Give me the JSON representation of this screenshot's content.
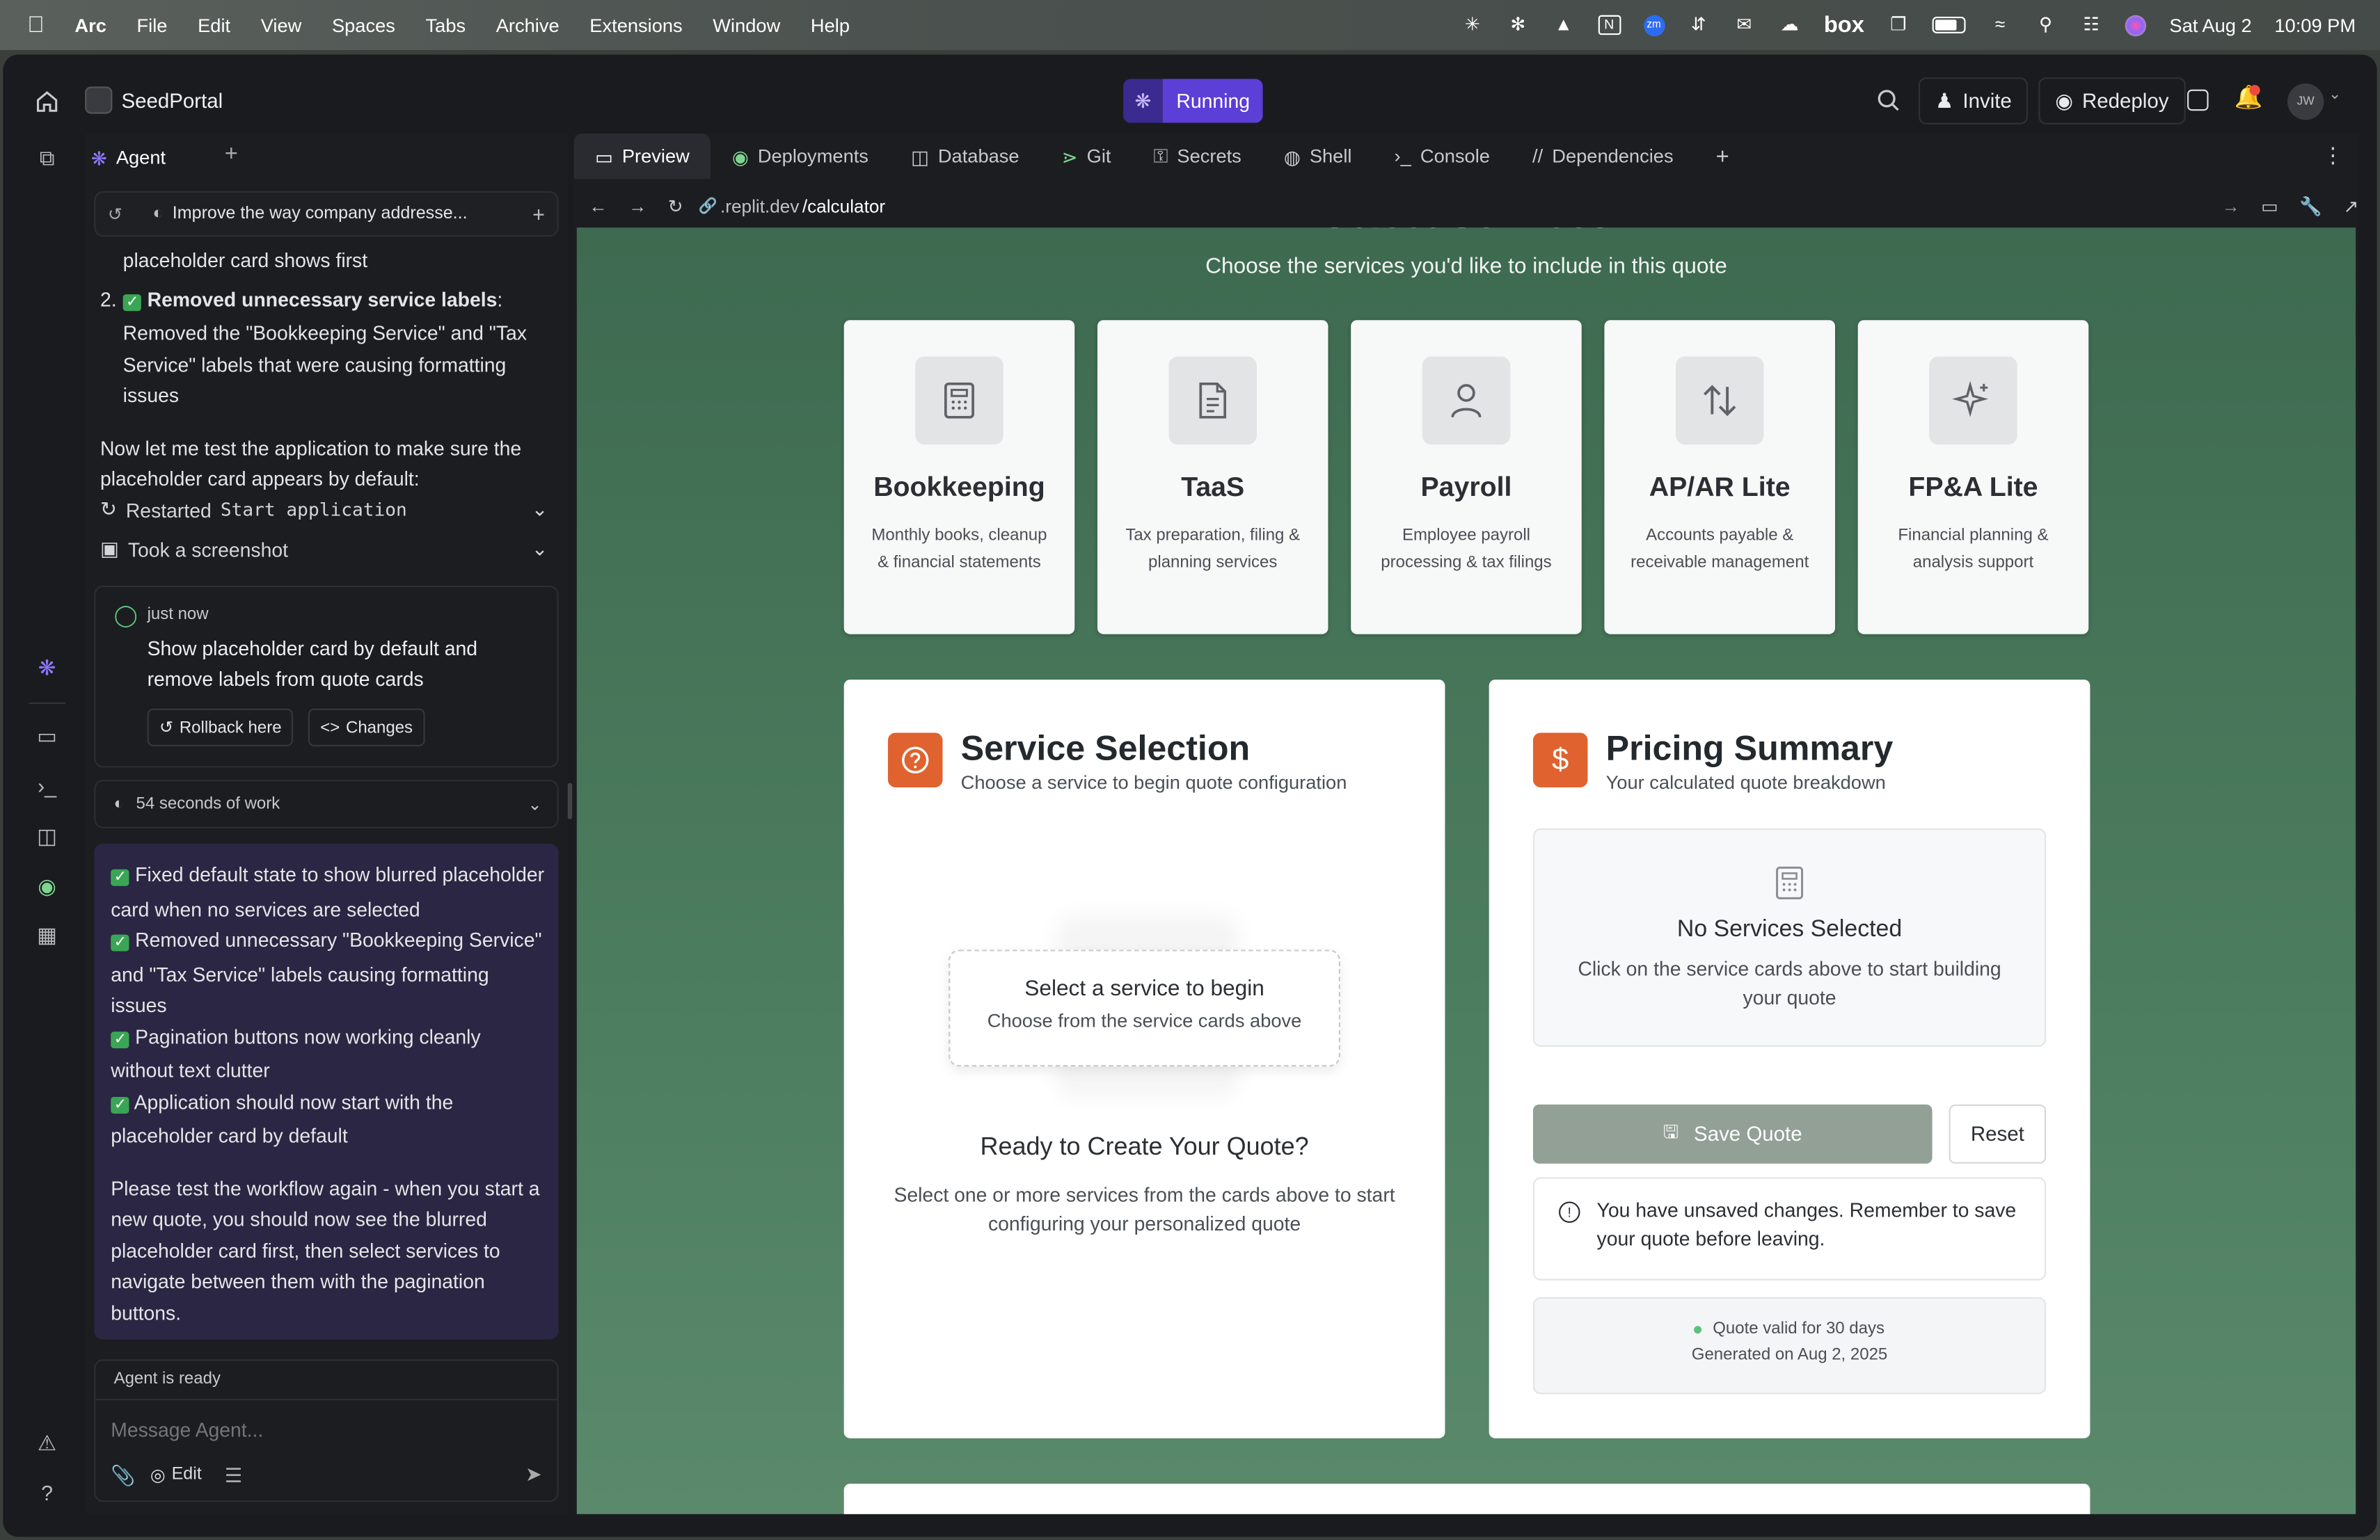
{
  "menubar": {
    "app": "Arc",
    "items": [
      "File",
      "Edit",
      "View",
      "Spaces",
      "Tabs",
      "Archive",
      "Extensions",
      "Window",
      "Help"
    ],
    "status_icons": [
      "sun-icon",
      "openai-icon",
      "drive-icon",
      "notion-icon",
      "zoom-icon",
      "sync-icon",
      "mail-icon",
      "cloud-icon"
    ],
    "box_label": "box",
    "date": "Sat Aug 2",
    "time": "10:09 PM"
  },
  "titlebar": {
    "project": "SeedPortal",
    "status": "Running",
    "invite": "Invite",
    "redeploy": "Redeploy",
    "avatar": "JW"
  },
  "agent": {
    "tab": "Agent",
    "history_title": "Improve the way company addresse...",
    "text_top": "placeholder card shows first",
    "item2_bold": "Removed unnecessary service labels",
    "item2_rest": ": Removed the \"Bookkeeping Service\" and \"Tax Service\" labels that were causing formatting issues",
    "para": "Now let me test the application to make sure the placeholder card appears by default:",
    "restart_prefix": "Restarted",
    "restart_code": "Start application",
    "screenshot": "Took a screenshot",
    "checkpoint": {
      "time": "just now",
      "text": "Show placeholder card by default and remove labels from quote cards",
      "rollback": "Rollback here",
      "changes": "Changes"
    },
    "work": "54 seconds of work",
    "summary": [
      "Fixed default state to show blurred placeholder card when no services are selected",
      "Removed unnecessary \"Bookkeeping Service\" and \"Tax Service\" labels causing formatting issues",
      "Pagination buttons now working cleanly without text clutter",
      "Application should now start with the placeholder card by default"
    ],
    "closing": "Please test the workflow again - when you start a new quote, you should now see the blurred placeholder card first, then select services to navigate between them with the pagination buttons.",
    "ready": "Agent is ready",
    "placeholder": "Message Agent...",
    "edit": "Edit"
  },
  "tabs": [
    "Preview",
    "Deployments",
    "Database",
    "Git",
    "Secrets",
    "Shell",
    "Console",
    "Dependencies"
  ],
  "url": {
    "prefix": ".replit.dev",
    "path": "/calculator"
  },
  "page": {
    "heading_partial": "Select Services",
    "subtitle": "Choose the services you'd like to include in this quote",
    "services": [
      {
        "title": "Bookkeeping",
        "desc": "Monthly books, cleanup & financial statements",
        "icon": "calculator-icon"
      },
      {
        "title": "TaaS",
        "desc": "Tax preparation, filing & planning services",
        "icon": "document-icon"
      },
      {
        "title": "Payroll",
        "desc": "Employee payroll processing & tax filings",
        "icon": "person-icon"
      },
      {
        "title": "AP/AR Lite",
        "desc": "Accounts payable & receivable management",
        "icon": "arrows-updown-icon"
      },
      {
        "title": "FP&A Lite",
        "desc": "Financial planning & analysis support",
        "icon": "sparkle-icon"
      }
    ],
    "selection": {
      "title": "Service Selection",
      "sub": "Choose a service to begin quote configuration",
      "ph_title": "Select a service to begin",
      "ph_sub": "Choose from the service cards above",
      "ready": "Ready to Create Your Quote?",
      "ready_sub": "Select one or more services from the cards above to start configuring your personalized quote"
    },
    "pricing": {
      "title": "Pricing Summary",
      "sub": "Your calculated quote breakdown",
      "none": "No Services Selected",
      "none_sub": "Click on the service cards above to start building your quote",
      "save": "Save Quote",
      "reset": "Reset",
      "warn": "You have unsaved changes. Remember to save your quote before leaving.",
      "valid": "Quote valid for 30 days",
      "generated": "Generated on Aug 2, 2025"
    }
  },
  "colors": {
    "accent": "#e0622e",
    "running": "#5b3fd6",
    "bg_green": "#4d7d5f"
  }
}
